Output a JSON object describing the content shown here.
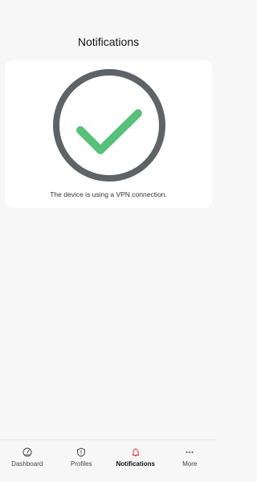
{
  "header": {
    "title": "Notifications"
  },
  "status_card": {
    "icon": "checkmark-circle-icon",
    "message": "The device is using a VPN connection.",
    "ring_color": "#5f6368",
    "check_color": "#57c07a"
  },
  "bottom_nav": {
    "active": "Notifications",
    "active_color": "#e53935",
    "items": [
      {
        "label": "Dashboard",
        "icon": "speedometer-icon"
      },
      {
        "label": "Profiles",
        "icon": "shield-icon"
      },
      {
        "label": "Notifications",
        "icon": "bell-icon"
      },
      {
        "label": "More",
        "icon": "more-dots-icon"
      }
    ]
  }
}
